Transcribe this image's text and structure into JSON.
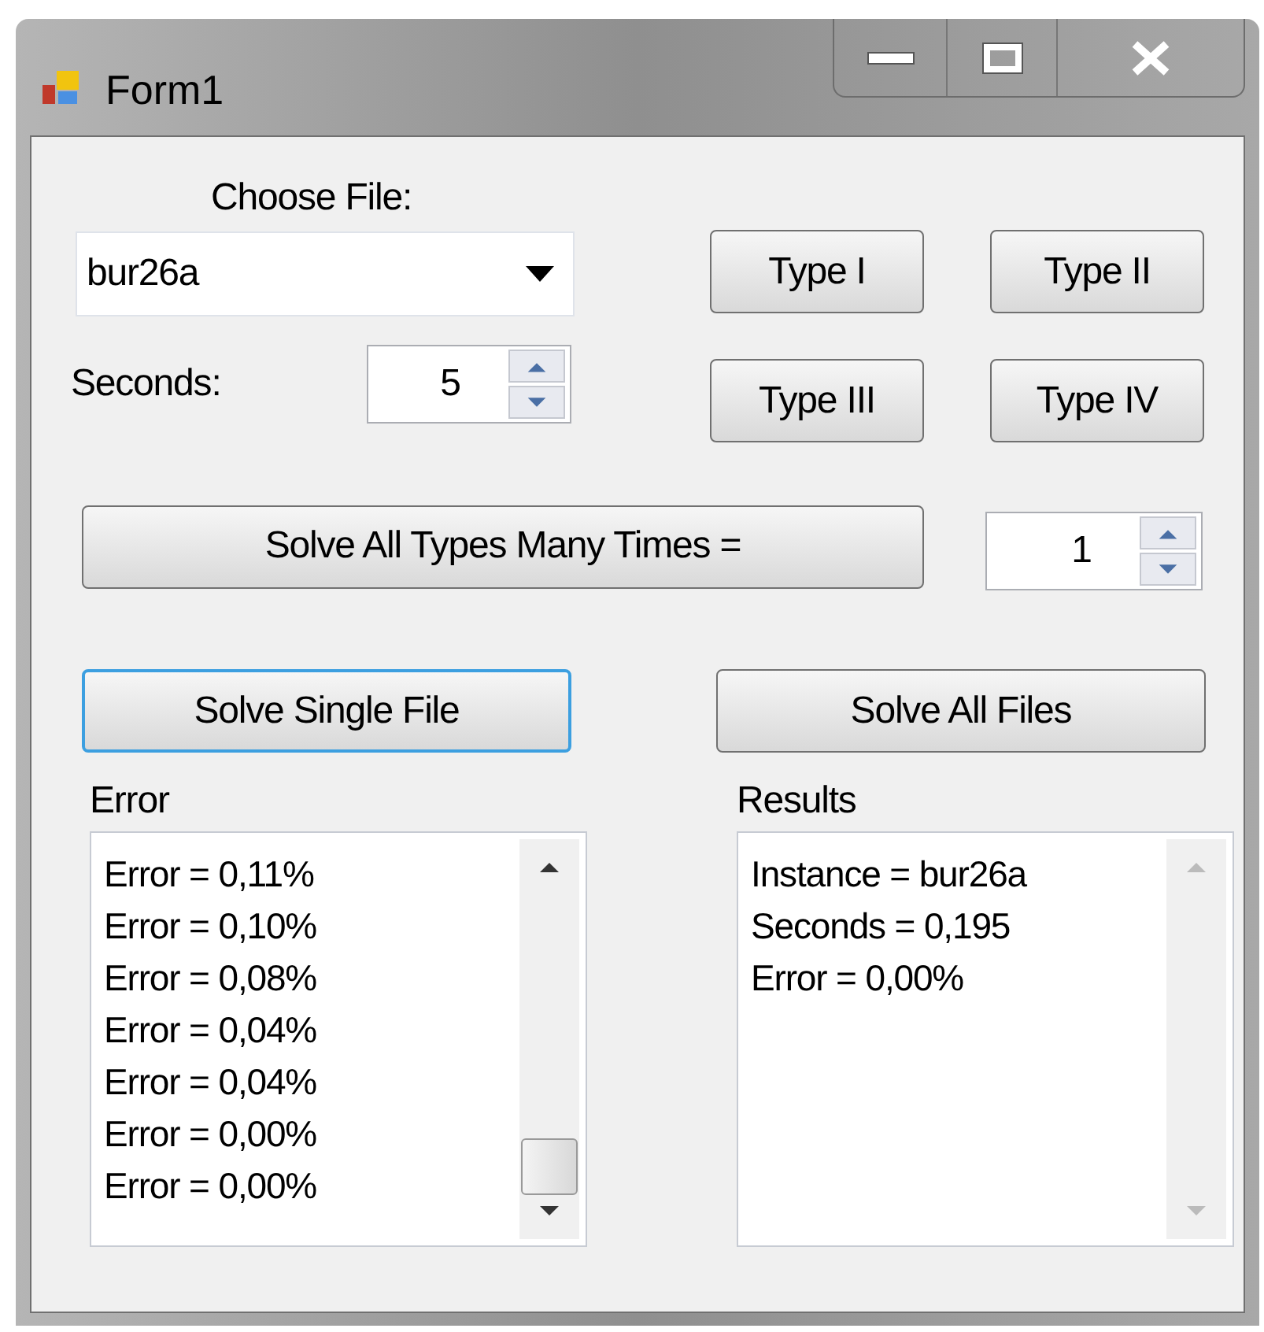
{
  "window": {
    "title": "Form1"
  },
  "file": {
    "label": "Choose File:",
    "value": "bur26a"
  },
  "seconds": {
    "label": "Seconds:",
    "value": "5"
  },
  "type_buttons": [
    {
      "label": "Type I"
    },
    {
      "label": "Type II"
    },
    {
      "label": "Type III"
    },
    {
      "label": "Type IV"
    }
  ],
  "solve_many": {
    "label": "Solve All Types Many Times =",
    "value": "1"
  },
  "solve_buttons": [
    {
      "label": "Solve Single File",
      "focused": true
    },
    {
      "label": "Solve All Files",
      "focused": false
    }
  ],
  "error_panel": {
    "label": "Error",
    "lines": [
      "Error = 0,11%",
      "Error = 0,10%",
      "Error = 0,08%",
      "Error = 0,04%",
      "Error = 0,04%",
      "Error = 0,00%",
      "Error = 0,00%"
    ],
    "scrollable": true
  },
  "results_panel": {
    "label": "Results",
    "lines": [
      "Instance = bur26a",
      "Seconds = 0,195",
      "Error = 0,00%"
    ],
    "scrollable": false
  }
}
